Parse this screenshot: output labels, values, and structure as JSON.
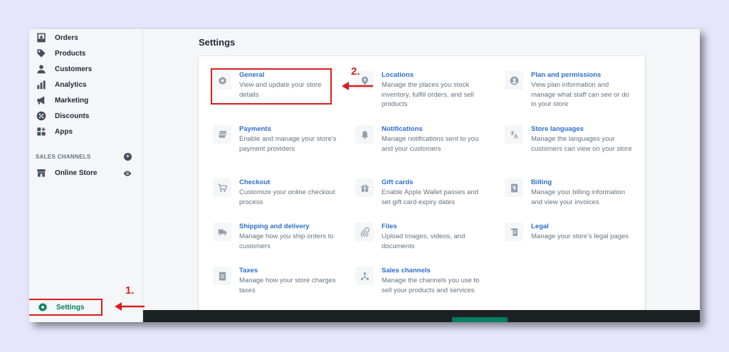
{
  "sidebar": {
    "items": [
      {
        "label": "Orders",
        "icon": "orders-icon"
      },
      {
        "label": "Products",
        "icon": "tag-icon"
      },
      {
        "label": "Customers",
        "icon": "person-icon"
      },
      {
        "label": "Analytics",
        "icon": "bar-chart-icon"
      },
      {
        "label": "Marketing",
        "icon": "megaphone-icon"
      },
      {
        "label": "Discounts",
        "icon": "discount-icon"
      },
      {
        "label": "Apps",
        "icon": "apps-icon"
      }
    ],
    "sales_channels_label": "SALES CHANNELS",
    "add_symbol": "+",
    "online_store_label": "Online Store",
    "settings_label": "Settings"
  },
  "annotations": {
    "step1": "1.",
    "step2": "2.",
    "color": "#d71e1e"
  },
  "main": {
    "title": "Settings",
    "settings": [
      {
        "title": "General",
        "desc": "View and update your store details",
        "icon": "gear-icon"
      },
      {
        "title": "Locations",
        "desc": "Manage the places you stock inventory, fulfill orders, and sell products",
        "icon": "location-pin-icon"
      },
      {
        "title": "Plan and permissions",
        "desc": "View plan information and manage what staff can see or do in your store",
        "icon": "user-circle-icon"
      },
      {
        "title": "Payments",
        "desc": "Enable and manage your store's payment providers",
        "icon": "credit-card-icon"
      },
      {
        "title": "Notifications",
        "desc": "Manage notifications sent to you and your customers",
        "icon": "bell-icon"
      },
      {
        "title": "Store languages",
        "desc": "Manage the languages your customers can view on your store",
        "icon": "translate-icon"
      },
      {
        "title": "Checkout",
        "desc": "Customize your online checkout process",
        "icon": "cart-icon"
      },
      {
        "title": "Gift cards",
        "desc": "Enable Apple Wallet passes and set gift card expiry dates",
        "icon": "gift-icon"
      },
      {
        "title": "Billing",
        "desc": "Manage your billing information and view your invoices",
        "icon": "billing-icon"
      },
      {
        "title": "Shipping and delivery",
        "desc": "Manage how you ship orders to customers",
        "icon": "truck-icon"
      },
      {
        "title": "Files",
        "desc": "Upload images, videos, and documents",
        "icon": "paperclip-icon"
      },
      {
        "title": "Legal",
        "desc": "Manage your store's legal pages",
        "icon": "legal-icon"
      },
      {
        "title": "Taxes",
        "desc": "Manage how your store charges taxes",
        "icon": "tax-icon"
      },
      {
        "title": "Sales channels",
        "desc": "Manage the channels you use to sell your products and services",
        "icon": "sales-channels-icon"
      }
    ]
  },
  "colors": {
    "accent": "#008060",
    "link": "#2c6ecb",
    "background": "#e6e5fb"
  }
}
